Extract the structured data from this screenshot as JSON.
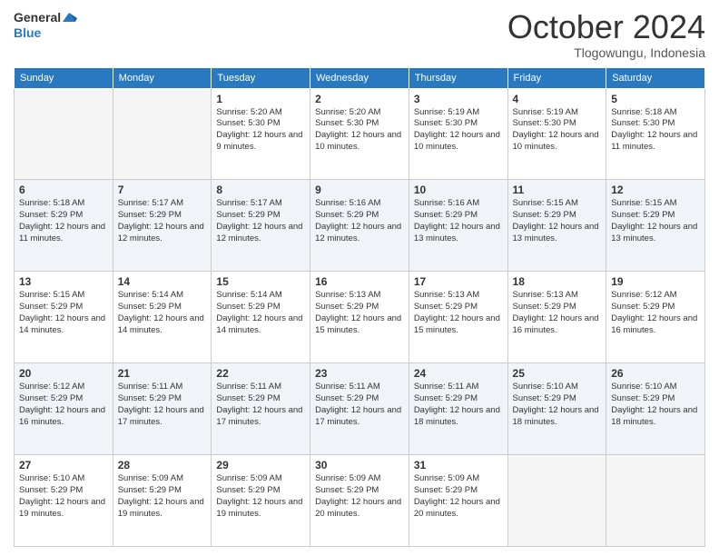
{
  "logo": {
    "general": "General",
    "blue": "Blue"
  },
  "title": "October 2024",
  "subtitle": "Tlogowungu, Indonesia",
  "days_of_week": [
    "Sunday",
    "Monday",
    "Tuesday",
    "Wednesday",
    "Thursday",
    "Friday",
    "Saturday"
  ],
  "weeks": [
    [
      {
        "day": "",
        "empty": true
      },
      {
        "day": "",
        "empty": true
      },
      {
        "day": "1",
        "sunrise": "Sunrise: 5:20 AM",
        "sunset": "Sunset: 5:30 PM",
        "daylight": "Daylight: 12 hours and 9 minutes."
      },
      {
        "day": "2",
        "sunrise": "Sunrise: 5:20 AM",
        "sunset": "Sunset: 5:30 PM",
        "daylight": "Daylight: 12 hours and 10 minutes."
      },
      {
        "day": "3",
        "sunrise": "Sunrise: 5:19 AM",
        "sunset": "Sunset: 5:30 PM",
        "daylight": "Daylight: 12 hours and 10 minutes."
      },
      {
        "day": "4",
        "sunrise": "Sunrise: 5:19 AM",
        "sunset": "Sunset: 5:30 PM",
        "daylight": "Daylight: 12 hours and 10 minutes."
      },
      {
        "day": "5",
        "sunrise": "Sunrise: 5:18 AM",
        "sunset": "Sunset: 5:30 PM",
        "daylight": "Daylight: 12 hours and 11 minutes."
      }
    ],
    [
      {
        "day": "6",
        "sunrise": "Sunrise: 5:18 AM",
        "sunset": "Sunset: 5:29 PM",
        "daylight": "Daylight: 12 hours and 11 minutes."
      },
      {
        "day": "7",
        "sunrise": "Sunrise: 5:17 AM",
        "sunset": "Sunset: 5:29 PM",
        "daylight": "Daylight: 12 hours and 12 minutes."
      },
      {
        "day": "8",
        "sunrise": "Sunrise: 5:17 AM",
        "sunset": "Sunset: 5:29 PM",
        "daylight": "Daylight: 12 hours and 12 minutes."
      },
      {
        "day": "9",
        "sunrise": "Sunrise: 5:16 AM",
        "sunset": "Sunset: 5:29 PM",
        "daylight": "Daylight: 12 hours and 12 minutes."
      },
      {
        "day": "10",
        "sunrise": "Sunrise: 5:16 AM",
        "sunset": "Sunset: 5:29 PM",
        "daylight": "Daylight: 12 hours and 13 minutes."
      },
      {
        "day": "11",
        "sunrise": "Sunrise: 5:15 AM",
        "sunset": "Sunset: 5:29 PM",
        "daylight": "Daylight: 12 hours and 13 minutes."
      },
      {
        "day": "12",
        "sunrise": "Sunrise: 5:15 AM",
        "sunset": "Sunset: 5:29 PM",
        "daylight": "Daylight: 12 hours and 13 minutes."
      }
    ],
    [
      {
        "day": "13",
        "sunrise": "Sunrise: 5:15 AM",
        "sunset": "Sunset: 5:29 PM",
        "daylight": "Daylight: 12 hours and 14 minutes."
      },
      {
        "day": "14",
        "sunrise": "Sunrise: 5:14 AM",
        "sunset": "Sunset: 5:29 PM",
        "daylight": "Daylight: 12 hours and 14 minutes."
      },
      {
        "day": "15",
        "sunrise": "Sunrise: 5:14 AM",
        "sunset": "Sunset: 5:29 PM",
        "daylight": "Daylight: 12 hours and 14 minutes."
      },
      {
        "day": "16",
        "sunrise": "Sunrise: 5:13 AM",
        "sunset": "Sunset: 5:29 PM",
        "daylight": "Daylight: 12 hours and 15 minutes."
      },
      {
        "day": "17",
        "sunrise": "Sunrise: 5:13 AM",
        "sunset": "Sunset: 5:29 PM",
        "daylight": "Daylight: 12 hours and 15 minutes."
      },
      {
        "day": "18",
        "sunrise": "Sunrise: 5:13 AM",
        "sunset": "Sunset: 5:29 PM",
        "daylight": "Daylight: 12 hours and 16 minutes."
      },
      {
        "day": "19",
        "sunrise": "Sunrise: 5:12 AM",
        "sunset": "Sunset: 5:29 PM",
        "daylight": "Daylight: 12 hours and 16 minutes."
      }
    ],
    [
      {
        "day": "20",
        "sunrise": "Sunrise: 5:12 AM",
        "sunset": "Sunset: 5:29 PM",
        "daylight": "Daylight: 12 hours and 16 minutes."
      },
      {
        "day": "21",
        "sunrise": "Sunrise: 5:11 AM",
        "sunset": "Sunset: 5:29 PM",
        "daylight": "Daylight: 12 hours and 17 minutes."
      },
      {
        "day": "22",
        "sunrise": "Sunrise: 5:11 AM",
        "sunset": "Sunset: 5:29 PM",
        "daylight": "Daylight: 12 hours and 17 minutes."
      },
      {
        "day": "23",
        "sunrise": "Sunrise: 5:11 AM",
        "sunset": "Sunset: 5:29 PM",
        "daylight": "Daylight: 12 hours and 17 minutes."
      },
      {
        "day": "24",
        "sunrise": "Sunrise: 5:11 AM",
        "sunset": "Sunset: 5:29 PM",
        "daylight": "Daylight: 12 hours and 18 minutes."
      },
      {
        "day": "25",
        "sunrise": "Sunrise: 5:10 AM",
        "sunset": "Sunset: 5:29 PM",
        "daylight": "Daylight: 12 hours and 18 minutes."
      },
      {
        "day": "26",
        "sunrise": "Sunrise: 5:10 AM",
        "sunset": "Sunset: 5:29 PM",
        "daylight": "Daylight: 12 hours and 18 minutes."
      }
    ],
    [
      {
        "day": "27",
        "sunrise": "Sunrise: 5:10 AM",
        "sunset": "Sunset: 5:29 PM",
        "daylight": "Daylight: 12 hours and 19 minutes."
      },
      {
        "day": "28",
        "sunrise": "Sunrise: 5:09 AM",
        "sunset": "Sunset: 5:29 PM",
        "daylight": "Daylight: 12 hours and 19 minutes."
      },
      {
        "day": "29",
        "sunrise": "Sunrise: 5:09 AM",
        "sunset": "Sunset: 5:29 PM",
        "daylight": "Daylight: 12 hours and 19 minutes."
      },
      {
        "day": "30",
        "sunrise": "Sunrise: 5:09 AM",
        "sunset": "Sunset: 5:29 PM",
        "daylight": "Daylight: 12 hours and 20 minutes."
      },
      {
        "day": "31",
        "sunrise": "Sunrise: 5:09 AM",
        "sunset": "Sunset: 5:29 PM",
        "daylight": "Daylight: 12 hours and 20 minutes."
      },
      {
        "day": "",
        "empty": true
      },
      {
        "day": "",
        "empty": true
      }
    ]
  ]
}
